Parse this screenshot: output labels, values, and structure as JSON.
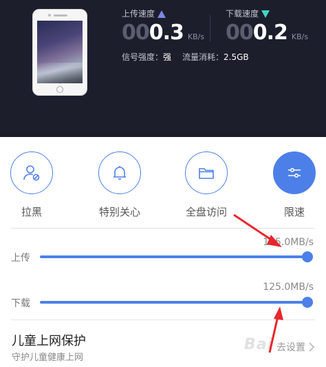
{
  "header": {
    "upload": {
      "label": "上传速度",
      "dim_digits": "00",
      "value": "0.3",
      "unit": "KB/s"
    },
    "download": {
      "label": "下载速度",
      "dim_digits": "00",
      "value": "0.2",
      "unit": "KB/s"
    },
    "signal_label": "信号强度：",
    "signal_value": "强",
    "traffic_label": "流量消耗：",
    "traffic_value": "2.5GB"
  },
  "actions": [
    {
      "label": "拉黑",
      "icon": "user-block-icon"
    },
    {
      "label": "特别关心",
      "icon": "bell-icon"
    },
    {
      "label": "全盘访问",
      "icon": "folder-icon"
    },
    {
      "label": "限速",
      "icon": "sliders-icon"
    }
  ],
  "limits": {
    "upload": {
      "label": "上传",
      "max": "125.0MB/s",
      "level": 1.0
    },
    "download": {
      "label": "下载",
      "max": "125.0MB/s",
      "level": 1.0
    }
  },
  "child_protection": {
    "title": "儿童上网保护",
    "subtitle": "守护儿童健康上网",
    "link": "去设置"
  },
  "watermark": "Bai",
  "colors": {
    "accent": "#4c80e8",
    "header_bg": "#1c1e2c",
    "annotation": "#e8262c"
  }
}
